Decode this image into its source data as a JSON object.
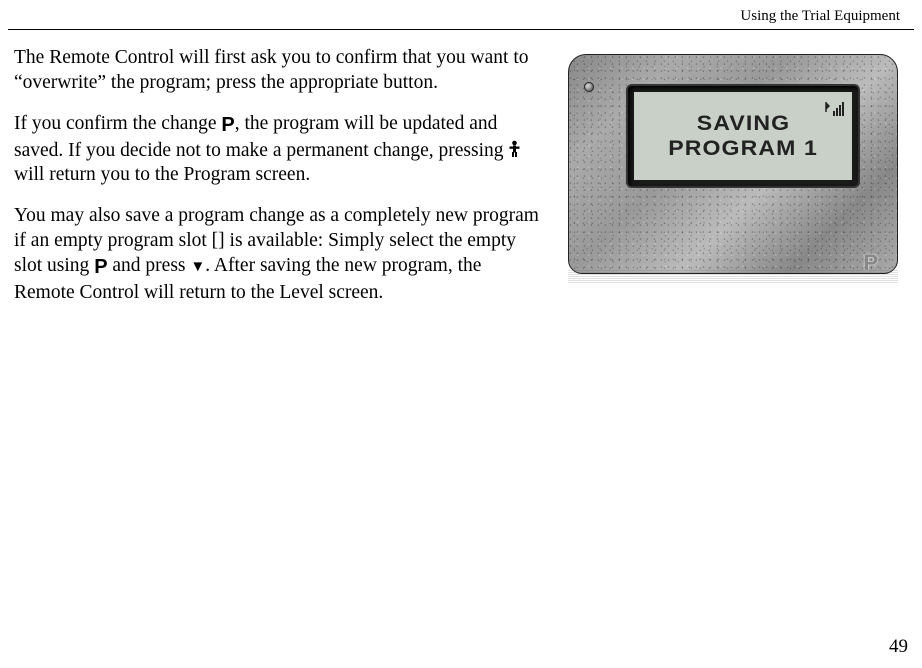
{
  "header": {
    "title": "Using the Trial Equipment"
  },
  "paragraphs": {
    "p1": "The Remote Control will first ask you to confirm that you want to “overwrite” the program; press the appropriate button.",
    "p2_a": "If you confirm the change ",
    "p2_b": ", the program will be updated and saved. If you decide not to make a permanent change, pressing ",
    "p2_c": " will return you to the Program screen.",
    "p3_a": "You may also save a program change as a completely new program if an empty program slot [] is available: Simply select the empty slot using ",
    "p3_b": " and press ",
    "p3_c": ". After saving the new program, the Remote Control will return to the Level screen."
  },
  "symbols": {
    "p_button": "P",
    "down_triangle": "▼"
  },
  "lcd": {
    "line1": "Saving",
    "line2": "Program 1"
  },
  "page_number": "49"
}
